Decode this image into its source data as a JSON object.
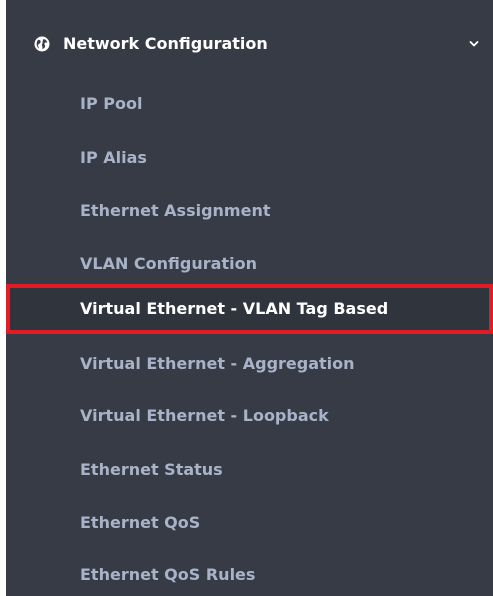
{
  "section": {
    "title": "Network Configuration",
    "icon": "globe-icon",
    "toggle_icon": "chevron-down-icon"
  },
  "menu": {
    "items": [
      {
        "label": "IP Pool"
      },
      {
        "label": "IP Alias"
      },
      {
        "label": "Ethernet Assignment"
      },
      {
        "label": "VLAN Configuration"
      },
      {
        "label": "Virtual Ethernet - VLAN Tag Based",
        "active": true
      },
      {
        "label": "Virtual Ethernet - Aggregation"
      },
      {
        "label": "Virtual Ethernet - Loopback"
      },
      {
        "label": "Ethernet Status"
      },
      {
        "label": "Ethernet QoS"
      },
      {
        "label": "Ethernet QoS Rules"
      }
    ]
  },
  "colors": {
    "sidebar_bg": "#363b45",
    "item_text": "#a9b3c8",
    "active_text": "#ffffff",
    "highlight_border": "#e21b24"
  }
}
